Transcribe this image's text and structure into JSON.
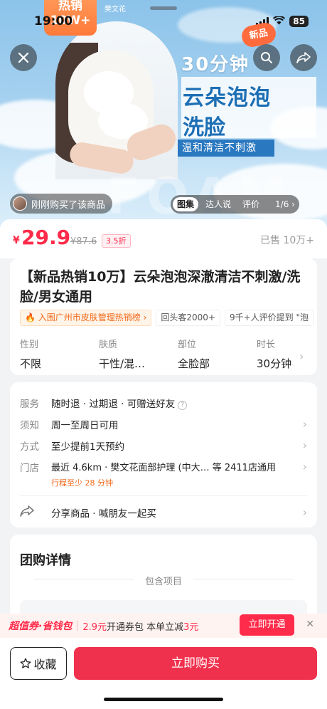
{
  "status_bar": {
    "time": "19:00",
    "battery": "85"
  },
  "hero": {
    "sale_tag_line1": "热销",
    "sale_tag_line2": "10W+",
    "brand_mini": "樊文花",
    "new_badge": "新品",
    "banner_duration": "30分钟",
    "banner_title_line1": "云朵泡泡",
    "banner_title_line2": "洗脸",
    "banner_subtitle": "温和清洁不刺激",
    "watermark_word": "FOAM",
    "recent_purchase": "刚刚购买了该商品",
    "media_tabs": [
      "图集",
      "达人说",
      "评价"
    ],
    "page_indicator": "1/6 ›"
  },
  "price": {
    "currency": "¥",
    "current": "29.9",
    "original": "¥87.6",
    "discount": "3.5折",
    "sold": "已售 10万+"
  },
  "product": {
    "title": "【新品热销10万】云朵泡泡深澈清洁不刺激/洗脸/男女通用",
    "tags": [
      "🔥 入围广州市皮肤管理热销榜 ›",
      "回头客2000+",
      "9千+人评价提到 \"泡"
    ],
    "specs": [
      {
        "key": "性别",
        "value": "不限"
      },
      {
        "key": "肤质",
        "value": "干性/混…"
      },
      {
        "key": "部位",
        "value": "全脸部"
      },
      {
        "key": "时长",
        "value": "30分钟"
      }
    ]
  },
  "info": {
    "rows": [
      {
        "key": "服务",
        "value": "随时退 · 过期退 · 可赠送好友"
      },
      {
        "key": "须知",
        "value": "周一至周日可用"
      },
      {
        "key": "方式",
        "value": "至少提前1天预约"
      },
      {
        "key": "门店",
        "value": "最近 4.6km · 樊文花面部护理 (中大… 等 2411店通用"
      }
    ],
    "travel_note": "行程至少 28 分钟",
    "share_label": "分享商品 · 喊朋友一起买"
  },
  "details": {
    "title": "团购详情",
    "contains_label": "包含项目"
  },
  "promo": {
    "brand": "超值券·省钱包",
    "price_prefix": "2.9元",
    "text_mid": "开通券包 本单立减",
    "save_amount": "3元",
    "button": "立即开通",
    "close": "✕"
  },
  "actions": {
    "favorite": "收藏",
    "buy": "立即购买"
  }
}
